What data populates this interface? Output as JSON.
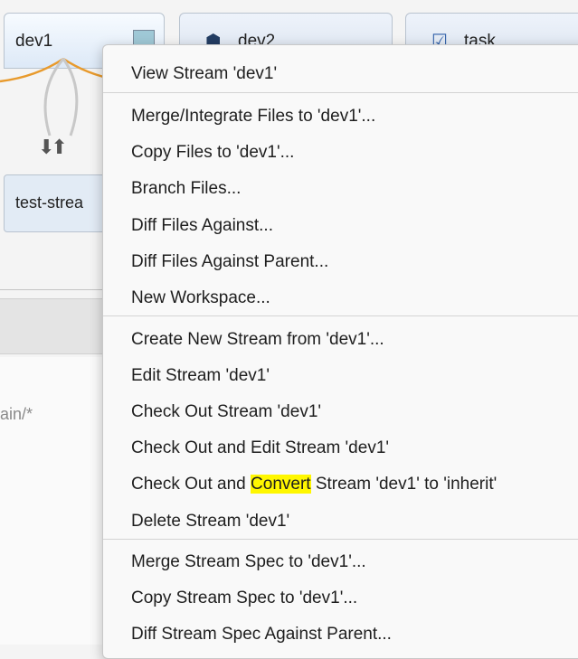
{
  "tabs": [
    {
      "label": "dev1",
      "icon": "stream-square-icon"
    },
    {
      "label": "dev2",
      "icon": "cube-icon"
    },
    {
      "label": "task",
      "icon": "task-checkbox-icon"
    }
  ],
  "child_stream": {
    "label": "test-strea"
  },
  "left_panel": {
    "path_text": "ain/*"
  },
  "menu": {
    "items": [
      "View Stream 'dev1'",
      "Merge/Integrate Files to 'dev1'...",
      "Copy Files to 'dev1'...",
      "Branch Files...",
      "Diff Files Against...",
      "Diff Files Against Parent...",
      "New Workspace...",
      "Create New Stream from 'dev1'...",
      "Edit Stream 'dev1'",
      "Check Out Stream 'dev1'",
      "Check Out and Edit Stream 'dev1'",
      "Delete Stream 'dev1'",
      "Merge Stream Spec to 'dev1'...",
      "Copy Stream Spec to 'dev1'...",
      "Diff Stream Spec Against Parent..."
    ],
    "convert_item": {
      "before": "Check Out and ",
      "highlight": "Convert",
      "after": " Stream 'dev1' to 'inherit'"
    },
    "highlight_color": "#fff700"
  }
}
